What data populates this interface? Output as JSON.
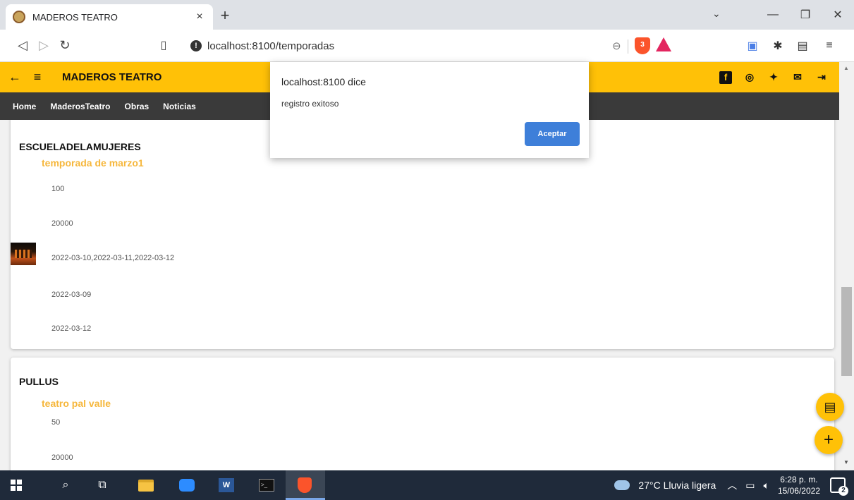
{
  "browser": {
    "tab_title": "MADEROS TEATRO",
    "tab_close": "×",
    "new_tab": "+",
    "url": "localhost:8100/temporadas",
    "shield_count": "3",
    "win_minimize": "—",
    "win_maximize": "❐",
    "win_close": "✕",
    "tab_dropdown": "⌄"
  },
  "app": {
    "title": "MADEROS TEATRO",
    "nav": [
      "Home",
      "MaderosTeatro",
      "Obras",
      "Noticias"
    ]
  },
  "cards": [
    {
      "title": "ESCUELADELAMUJERES",
      "season": "temporada de marzo1",
      "details": [
        "100",
        "20000",
        "2022-03-10,2022-03-11,2022-03-12",
        "2022-03-09",
        "2022-03-12"
      ]
    },
    {
      "title": "PULLUS",
      "season": "teatro pal valle",
      "details": [
        "50",
        "20000"
      ]
    }
  ],
  "dialog": {
    "title": "localhost:8100 dice",
    "message": "registro exitoso",
    "button": "Aceptar"
  },
  "taskbar": {
    "weather": "27°C  Lluvia ligera",
    "time": "6:28 p. m.",
    "date": "15/06/2022",
    "notifications": "2"
  },
  "colors": {
    "accent": "#ffc107",
    "nav_bg": "#3a3a3a",
    "season_text": "#f6b73c",
    "dialog_button": "#3e7fd9"
  }
}
